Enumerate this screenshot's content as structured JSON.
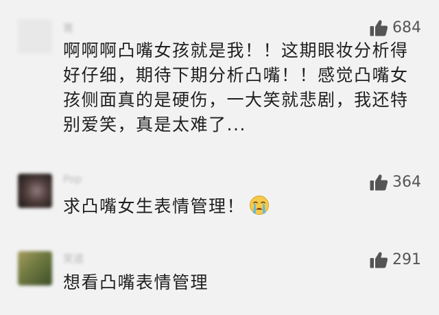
{
  "comments": [
    {
      "username": "箐",
      "likes": "684",
      "text_lines": [
        "啊啊啊凸嘴女孩就是我！！这期眼妆分析得",
        "好仔细，期待下期分析凸嘴！！感觉凸嘴女",
        "孩侧面真的是硬伤，一大笑就悲剧，我还特",
        "别爱笑，真是太难了..."
      ]
    },
    {
      "username": "Pop",
      "likes": "364",
      "text": "求凸嘴女生表情管理！",
      "emoji": "crying-face"
    },
    {
      "username": "笑道",
      "likes": "291",
      "text": "想看凸嘴表情管理"
    }
  ],
  "colors": {
    "background": "#f2f2f2",
    "text": "#1f1f1f",
    "like_icon": "#555555",
    "username": "#b9b9b9"
  },
  "icons": {
    "like": "thumbs-up-icon"
  }
}
